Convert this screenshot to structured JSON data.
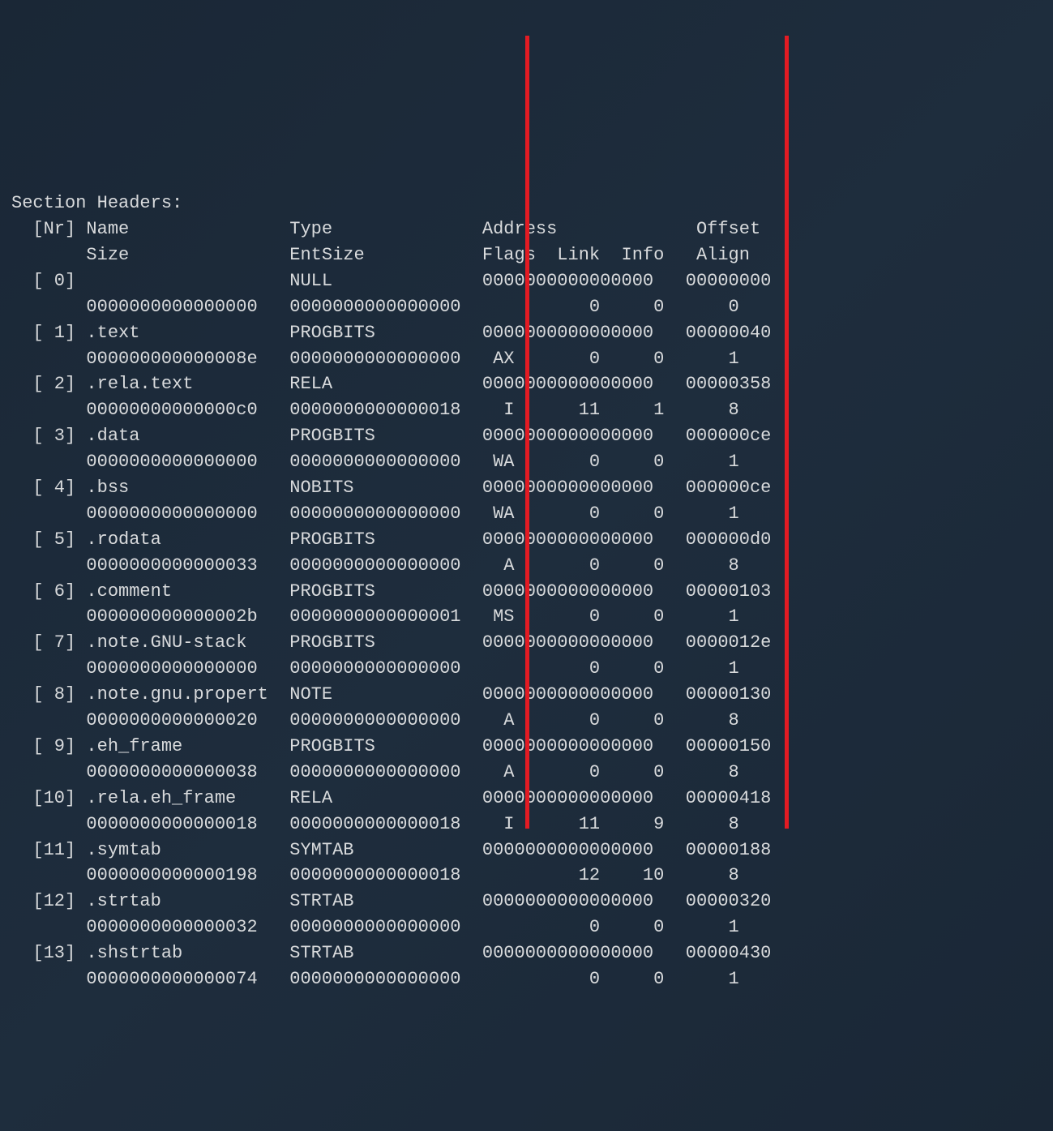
{
  "title": "Section Headers:",
  "header_row1": {
    "nr": "[Nr]",
    "name": "Name",
    "type": "Type",
    "address": "Address",
    "offset": "Offset"
  },
  "header_row2": {
    "size": "Size",
    "entsize": "EntSize",
    "flags": "Flags",
    "link": "Link",
    "info": "Info",
    "align": "Align"
  },
  "sections": [
    {
      "nr": "[ 0]",
      "name": "",
      "type": "NULL",
      "address": "0000000000000000",
      "offset": "00000000",
      "size": "0000000000000000",
      "entsize": "0000000000000000",
      "flags": "",
      "link": "0",
      "info": "0",
      "align": "0"
    },
    {
      "nr": "[ 1]",
      "name": ".text",
      "type": "PROGBITS",
      "address": "0000000000000000",
      "offset": "00000040",
      "size": "000000000000008e",
      "entsize": "0000000000000000",
      "flags": "AX",
      "link": "0",
      "info": "0",
      "align": "1"
    },
    {
      "nr": "[ 2]",
      "name": ".rela.text",
      "type": "RELA",
      "address": "0000000000000000",
      "offset": "00000358",
      "size": "00000000000000c0",
      "entsize": "0000000000000018",
      "flags": "I",
      "link": "11",
      "info": "1",
      "align": "8"
    },
    {
      "nr": "[ 3]",
      "name": ".data",
      "type": "PROGBITS",
      "address": "0000000000000000",
      "offset": "000000ce",
      "size": "0000000000000000",
      "entsize": "0000000000000000",
      "flags": "WA",
      "link": "0",
      "info": "0",
      "align": "1"
    },
    {
      "nr": "[ 4]",
      "name": ".bss",
      "type": "NOBITS",
      "address": "0000000000000000",
      "offset": "000000ce",
      "size": "0000000000000000",
      "entsize": "0000000000000000",
      "flags": "WA",
      "link": "0",
      "info": "0",
      "align": "1"
    },
    {
      "nr": "[ 5]",
      "name": ".rodata",
      "type": "PROGBITS",
      "address": "0000000000000000",
      "offset": "000000d0",
      "size": "0000000000000033",
      "entsize": "0000000000000000",
      "flags": "A",
      "link": "0",
      "info": "0",
      "align": "8"
    },
    {
      "nr": "[ 6]",
      "name": ".comment",
      "type": "PROGBITS",
      "address": "0000000000000000",
      "offset": "00000103",
      "size": "000000000000002b",
      "entsize": "0000000000000001",
      "flags": "MS",
      "link": "0",
      "info": "0",
      "align": "1"
    },
    {
      "nr": "[ 7]",
      "name": ".note.GNU-stack",
      "type": "PROGBITS",
      "address": "0000000000000000",
      "offset": "0000012e",
      "size": "0000000000000000",
      "entsize": "0000000000000000",
      "flags": "",
      "link": "0",
      "info": "0",
      "align": "1"
    },
    {
      "nr": "[ 8]",
      "name": ".note.gnu.propert",
      "type": "NOTE",
      "address": "0000000000000000",
      "offset": "00000130",
      "size": "0000000000000020",
      "entsize": "0000000000000000",
      "flags": "A",
      "link": "0",
      "info": "0",
      "align": "8"
    },
    {
      "nr": "[ 9]",
      "name": ".eh_frame",
      "type": "PROGBITS",
      "address": "0000000000000000",
      "offset": "00000150",
      "size": "0000000000000038",
      "entsize": "0000000000000000",
      "flags": "A",
      "link": "0",
      "info": "0",
      "align": "8"
    },
    {
      "nr": "[10]",
      "name": ".rela.eh_frame",
      "type": "RELA",
      "address": "0000000000000000",
      "offset": "00000418",
      "size": "0000000000000018",
      "entsize": "0000000000000018",
      "flags": "I",
      "link": "11",
      "info": "9",
      "align": "8"
    },
    {
      "nr": "[11]",
      "name": ".symtab",
      "type": "SYMTAB",
      "address": "0000000000000000",
      "offset": "00000188",
      "size": "0000000000000198",
      "entsize": "0000000000000018",
      "flags": "",
      "link": "12",
      "info": "10",
      "align": "8"
    },
    {
      "nr": "[12]",
      "name": ".strtab",
      "type": "STRTAB",
      "address": "0000000000000000",
      "offset": "00000320",
      "size": "0000000000000032",
      "entsize": "0000000000000000",
      "flags": "",
      "link": "0",
      "info": "0",
      "align": "1"
    },
    {
      "nr": "[13]",
      "name": ".shstrtab",
      "type": "STRTAB",
      "address": "0000000000000000",
      "offset": "00000430",
      "size": "0000000000000074",
      "entsize": "0000000000000000",
      "flags": "",
      "link": "0",
      "info": "0",
      "align": "1"
    }
  ]
}
